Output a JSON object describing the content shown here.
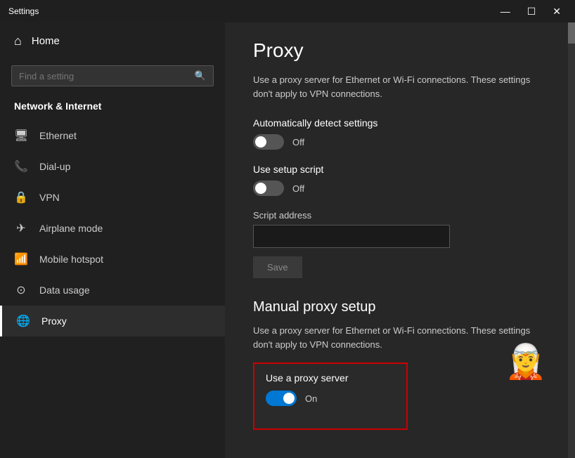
{
  "window": {
    "title": "Settings",
    "minimize_label": "—",
    "maximize_label": "☐",
    "close_label": "✕"
  },
  "sidebar": {
    "home_label": "Home",
    "search_placeholder": "Find a setting",
    "section_label": "Network & Internet",
    "nav_items": [
      {
        "id": "ethernet",
        "label": "Ethernet",
        "icon": "🖥"
      },
      {
        "id": "dial-up",
        "label": "Dial-up",
        "icon": "📞"
      },
      {
        "id": "vpn",
        "label": "VPN",
        "icon": "🔒"
      },
      {
        "id": "airplane",
        "label": "Airplane mode",
        "icon": "✈"
      },
      {
        "id": "hotspot",
        "label": "Mobile hotspot",
        "icon": "📶"
      },
      {
        "id": "data",
        "label": "Data usage",
        "icon": "⊙"
      },
      {
        "id": "proxy",
        "label": "Proxy",
        "icon": "🌐",
        "active": true
      }
    ]
  },
  "content": {
    "page_title": "Proxy",
    "description": "Use a proxy server for Ethernet or Wi-Fi connections. These settings don't apply to VPN connections.",
    "auto_detect": {
      "label": "Automatically detect settings",
      "state": "off",
      "status_label": "Off"
    },
    "setup_script": {
      "label": "Use setup script",
      "state": "off",
      "status_label": "Off"
    },
    "script_address": {
      "label": "Script address",
      "value": "",
      "placeholder": ""
    },
    "save_button_label": "Save",
    "manual_section_title": "Manual proxy setup",
    "manual_description": "Use a proxy server for Ethernet or Wi-Fi connections. These settings don't apply to VPN connections.",
    "use_proxy": {
      "label": "Use a proxy server",
      "state": "on",
      "status_label": "On"
    }
  }
}
